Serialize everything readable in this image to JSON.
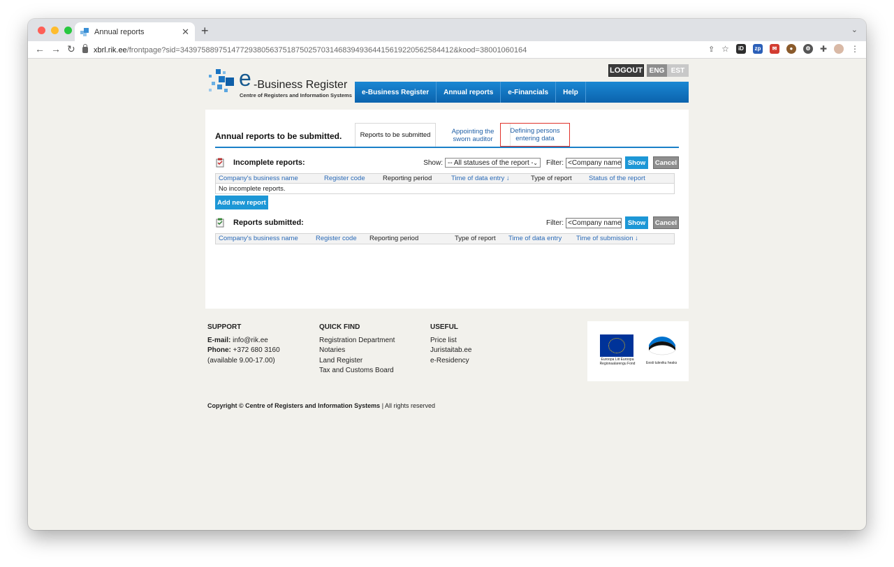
{
  "browser": {
    "tab_title": "Annual reports",
    "url_domain": "xbrl.rik.ee",
    "url_rest": "/frontpage?sid=3439758897514772938056375187502570314683949364415619220562584412&kood=38001060164"
  },
  "header": {
    "logo_title": "-Business Register",
    "logo_sub": "Centre of Registers and Information Systems",
    "logout": "LOGOUT",
    "lang_eng": "ENG",
    "lang_est": "EST",
    "nav": [
      "e-Business Register",
      "Annual reports",
      "e-Financials",
      "Help"
    ]
  },
  "panel": {
    "title": "Annual reports to be submitted.",
    "tabs": {
      "t1": "Reports to be submitted",
      "t2": "Appointing the sworn auditor",
      "t3": "Defining persons entering data"
    }
  },
  "incomplete": {
    "title": "Incomplete reports:",
    "show_label": "Show:",
    "select_value": "-- All statuses of the report --",
    "filter_label": "Filter:",
    "filter_value": "<Company name>",
    "show_btn": "Show",
    "cancel_btn": "Cancel",
    "columns": [
      "Company's business name",
      "Register code",
      "Reporting period",
      "Time of data entry ↓",
      "Type of report",
      "Status of the report"
    ],
    "empty": "No incomplete reports.",
    "add_btn": "Add new report"
  },
  "submitted": {
    "title": "Reports submitted:",
    "filter_label": "Filter:",
    "filter_value": "<Company name>",
    "show_btn": "Show",
    "cancel_btn": "Cancel",
    "columns": [
      "Company's business name",
      "Register code",
      "Reporting period",
      "Type of report",
      "Time of data entry",
      "Time of submission ↓"
    ]
  },
  "footer": {
    "support_head": "SUPPORT",
    "email_label": "E-mail:",
    "email": "info@rik.ee",
    "phone_label": "Phone:",
    "phone": "+372 680 3160 (available 9.00-17.00)",
    "quick_head": "QUICK FIND",
    "quick": [
      "Registration Department",
      "Notaries",
      "Land Register",
      "Tax and Customs Board"
    ],
    "useful_head": "USEFUL",
    "useful": [
      "Price list",
      "Juristaitab.ee",
      "e-Residency"
    ],
    "copyright_bold": "Copyright © Centre of Registers and Information Systems",
    "copyright_rest": "|  All rights reserved",
    "eu_caption": "Euroopa Liit Euroopa Regionaalarengu Fond",
    "est_caption": "Eesti tuleviku heaks"
  }
}
